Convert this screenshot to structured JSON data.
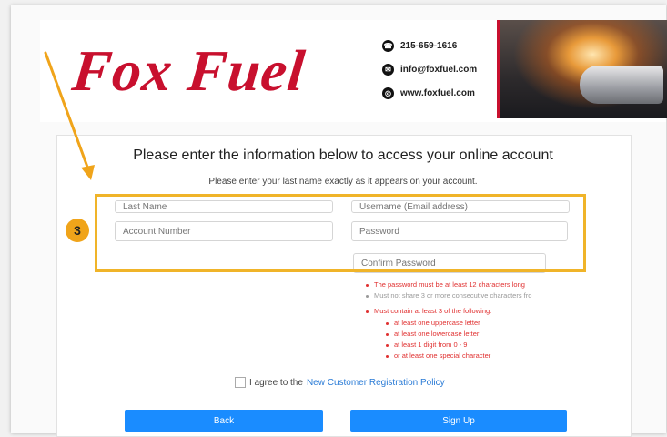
{
  "brand": {
    "logo_text": "Fox Fuel",
    "accent_color": "#c8102e"
  },
  "contact": {
    "phone": "215-659-1616",
    "email": "info@foxfuel.com",
    "website": "www.foxfuel.com",
    "phone_icon": "phone-icon",
    "email_icon": "email-icon",
    "web_icon": "globe-icon"
  },
  "form": {
    "title": "Please enter the information below to access your online account",
    "subtitle": "Please enter your last name exactly as it appears on your account.",
    "last_name_placeholder": "Last Name",
    "username_placeholder": "Username (Email address)",
    "account_number_placeholder": "Account Number",
    "password_placeholder": "Password",
    "confirm_password_placeholder": "Confirm Password"
  },
  "step_badge": "3",
  "password_rules": {
    "min_length": "The password must be at least 12 characters long",
    "no_consecutive": "Must not share 3 or more consecutive characters fro",
    "contains_header": "Must contain at least 3 of the following:",
    "contains_items": [
      "at least one uppercase letter",
      "at least one lowercase letter",
      "at least 1 digit from 0 - 9",
      "or at least one special character"
    ]
  },
  "agreement": {
    "prefix": "I agree to the",
    "link_text": "New Customer Registration Policy"
  },
  "buttons": {
    "back": "Back",
    "sign_up": "Sign Up",
    "color": "#1a8cff"
  },
  "highlight_color": "#f0b429"
}
